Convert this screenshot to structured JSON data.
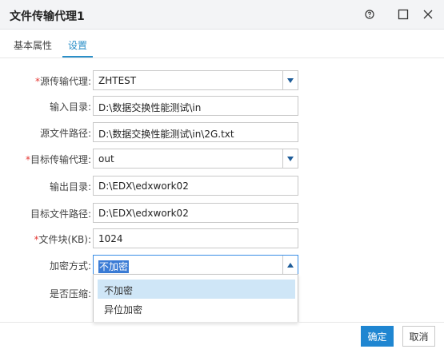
{
  "window": {
    "title": "文件传输代理1",
    "help_icon": "help-circle-icon",
    "maximize_icon": "maximize-icon",
    "close_icon": "close-icon"
  },
  "tabs": [
    {
      "label": "基本属性",
      "active": false
    },
    {
      "label": "设置",
      "active": true
    }
  ],
  "form": {
    "source_agent": {
      "label": "源传输代理:",
      "required": true,
      "value": "ZHTEST"
    },
    "input_dir": {
      "label": "输入目录:",
      "required": false,
      "value": "D:\\数据交换性能测试\\in"
    },
    "source_file_path": {
      "label": "源文件路径:",
      "required": false,
      "value": "D:\\数据交换性能测试\\in\\2G.txt"
    },
    "target_agent": {
      "label": "目标传输代理:",
      "required": true,
      "value": "out"
    },
    "output_dir": {
      "label": "输出目录:",
      "required": false,
      "value": "D:\\EDX\\edxwork02"
    },
    "target_file_path": {
      "label": "目标文件路径:",
      "required": false,
      "value": "D:\\EDX\\edxwork02"
    },
    "block_size": {
      "label": "文件块(KB):",
      "required": true,
      "value": "1024"
    },
    "encryption": {
      "label": "加密方式:",
      "required": false,
      "value": "不加密",
      "options": [
        "不加密",
        "异位加密"
      ]
    },
    "compress": {
      "label": "是否压缩:",
      "required": false
    }
  },
  "footer": {
    "ok_label": "确定",
    "cancel_label": "取消"
  },
  "colors": {
    "accent": "#2a8fc8",
    "required": "#e53935",
    "primary_button": "#1f86d1",
    "highlight": "#cfe6f7"
  }
}
